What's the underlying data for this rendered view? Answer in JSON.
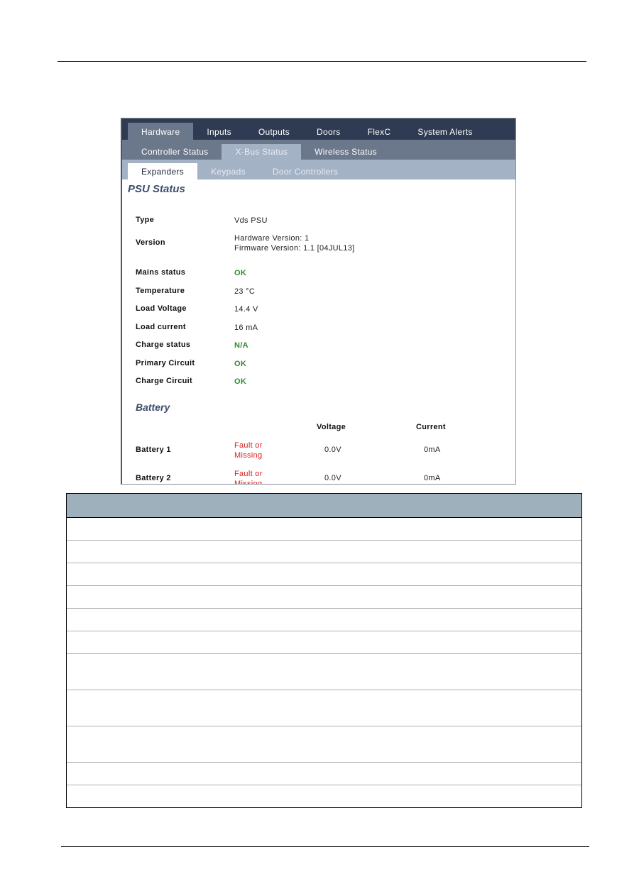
{
  "app": {
    "main_tabs": [
      {
        "label": "Hardware",
        "active": true
      },
      {
        "label": "Inputs",
        "active": false
      },
      {
        "label": "Outputs",
        "active": false
      },
      {
        "label": "Doors",
        "active": false
      },
      {
        "label": "FlexC",
        "active": false
      },
      {
        "label": "System Alerts",
        "active": false
      }
    ],
    "sub_tabs": [
      {
        "label": "Controller Status",
        "active": false
      },
      {
        "label": "X-Bus Status",
        "active": true
      },
      {
        "label": "Wireless Status",
        "active": false
      }
    ],
    "third_tabs": [
      {
        "label": "Expanders",
        "active": true
      },
      {
        "label": "Keypads",
        "active": false
      },
      {
        "label": "Door Controllers",
        "active": false
      }
    ]
  },
  "psu": {
    "title": "PSU Status",
    "type": {
      "label": "Type",
      "value": "Vds PSU"
    },
    "version": {
      "label": "Version",
      "hardware": "Hardware Version: 1",
      "firmware": "Firmware Version: 1.1 [04JUL13]"
    },
    "fields": [
      {
        "label": "Mains status",
        "value": "OK",
        "status": "ok"
      },
      {
        "label": "Temperature",
        "value": "23 °C",
        "status": "plain"
      },
      {
        "label": "Load Voltage",
        "value": "14.4 V",
        "status": "plain"
      },
      {
        "label": "Load current",
        "value": "16 mA",
        "status": "plain"
      },
      {
        "label": "Charge status",
        "value": "N/A",
        "status": "ok"
      },
      {
        "label": "Primary Circuit",
        "value": "OK",
        "status": "ok"
      },
      {
        "label": "Charge Circuit",
        "value": "OK",
        "status": "ok"
      }
    ]
  },
  "battery": {
    "title": "Battery",
    "col_voltage": "Voltage",
    "col_current": "Current",
    "rows": [
      {
        "label": "Battery 1",
        "status": "Fault or Missing",
        "voltage": "0.0V",
        "current": "0mA"
      },
      {
        "label": "Battery 2",
        "status": "Fault or Missing",
        "voltage": "0.0V",
        "current": "0mA"
      }
    ]
  },
  "colors": {
    "main_tab_bg": "#2f3b52",
    "sub_tab_bg": "#6b778a",
    "third_tab_bg": "#a4b2c6",
    "ok": "#2e8b2e",
    "fault": "#d42020",
    "title": "#3d4d6b",
    "table_header": "#9fb0bd"
  },
  "doc_table": {
    "header": "",
    "rows": [
      "",
      "",
      "",
      "",
      "",
      "",
      "",
      "",
      "",
      "",
      ""
    ]
  }
}
